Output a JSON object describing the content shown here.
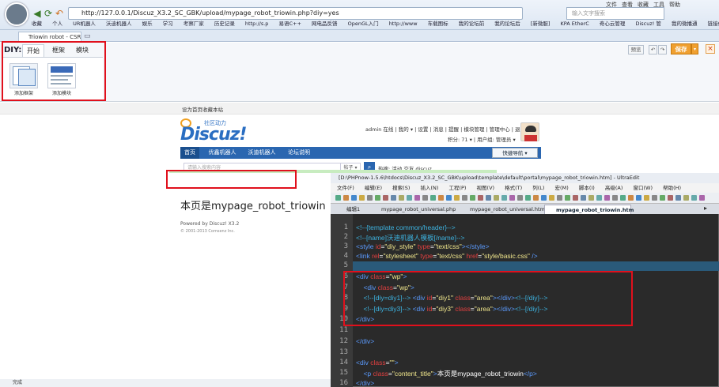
{
  "browser": {
    "url": "http://127.0.0.1/Discuz_X3.2_SC_GBK/upload/mypage_robot_triowin.php?diy=yes",
    "search_placeholder": "输入文字搜索",
    "menu": [
      "文件",
      "查看",
      "收藏",
      "工具",
      "帮助"
    ],
    "bookmarks": [
      "收藏",
      "个人",
      "UR机器人",
      "沃迪机器人",
      "娱乐",
      "学习",
      "考察厂家",
      "历史记录",
      "http://s.p",
      "易语C++",
      "网电品反馈",
      "OpenGL入门",
      "http://www",
      "车载图标",
      "我的论坛前",
      "我的论坛后",
      "[新微服]",
      "KPA EtherC",
      "奇心云管理",
      "Discuz! 管",
      "我的微播通",
      "链接借鉴"
    ],
    "tab_title": "Triowin robot - CSR..",
    "status": "完成"
  },
  "diy": {
    "label": "DIY:",
    "tabs": [
      "开始",
      "框架",
      "模块"
    ],
    "items": [
      "添加框架",
      "添加模块"
    ],
    "buttons": {
      "preview": "预览",
      "save": "保存"
    }
  },
  "site": {
    "top_links": [
      "设为首页",
      "收藏本站"
    ],
    "logo": "Discuz!",
    "logo_sub": "社区动力",
    "user_line": "admin 在线 | 我的 ▾ | 设置 | 消息 | 提醒 | 模块管理 | 管理中心 | 退出",
    "user_line2": "积分: 71 ▾ | 用户组: 管理员 ▾",
    "nav": [
      "首页",
      "优鑫机器人",
      "沃迪机器人",
      "论坛说明"
    ],
    "quick_nav": "快捷导航 ▾",
    "search_placeholder": "请输入搜索内容",
    "search_type": "帖子 ▾",
    "hot": "热搜:  活动  交友  discuz",
    "page_title": "本页是mypage_robot_triowin",
    "powered": "Powered by Discuz! X3.2",
    "copyright": "© 2001-2013 Comsenz Inc."
  },
  "editor": {
    "title": "[D:\\PHPnow-1.5.6\\htdocs\\Discuz_X3.2_SC_GBK\\upload\\template\\default\\portal\\mypage_robot_triowin.htm] - UltraEdit",
    "menu": [
      "文件(F)",
      "编辑(E)",
      "搜索(S)",
      "插入(N)",
      "工程(P)",
      "视图(V)",
      "格式(T)",
      "列(L)",
      "宏(M)",
      "脚本(I)",
      "高级(A)",
      "窗口(W)",
      "帮助(H)"
    ],
    "tabs": [
      "编辑1",
      "mypage_robot_universal.php",
      "mypage_robot_universal.htm",
      "mypage_robot_triowin.htm"
    ],
    "line_numbers": [
      "1",
      "2",
      "3",
      "4",
      "5",
      "6",
      "7",
      "8",
      "9",
      "10",
      "11",
      "12",
      "13",
      "14",
      "15",
      "16"
    ],
    "colors": {
      "comment": "#3db3e0",
      "tag": "#5b9bff",
      "attr": "#e04040",
      "value": "#f0e68c",
      "text": "#ffffff"
    }
  }
}
